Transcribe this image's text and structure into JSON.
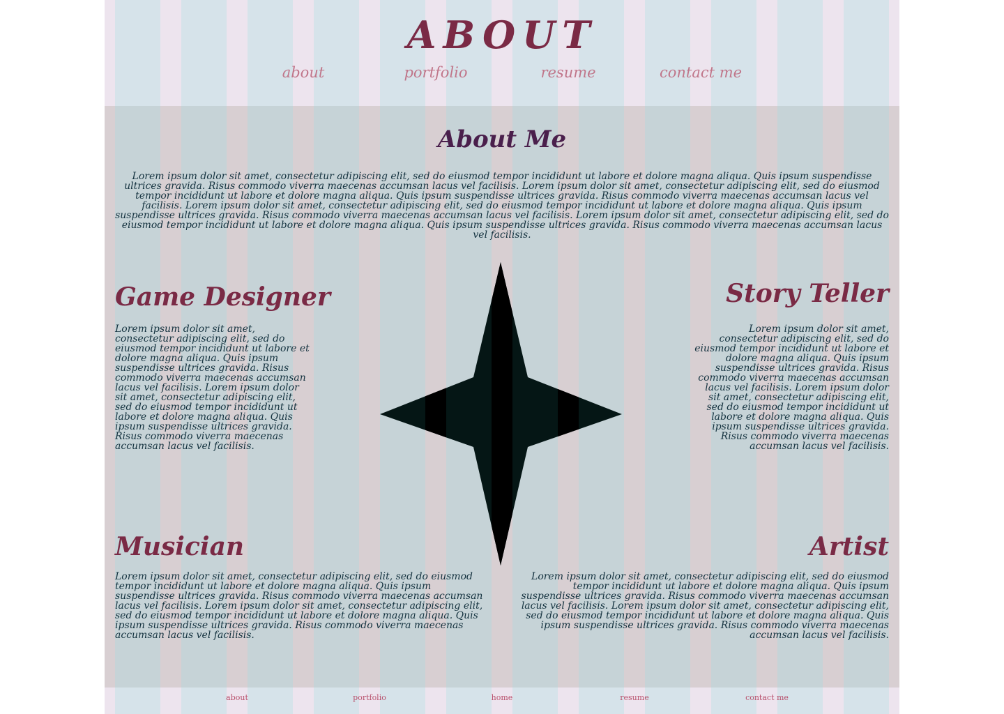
{
  "header": {
    "title": "ABOUT",
    "nav": [
      "about",
      "portfolio",
      "resume",
      "contact me"
    ]
  },
  "about": {
    "heading": "About Me",
    "intro": "Lorem ipsum dolor sit amet, consectetur adipiscing elit, sed do eiusmod tempor incididunt ut labore et dolore magna aliqua. Quis ipsum suspendisse ultrices gravida. Risus commodo viverra maecenas accumsan lacus vel facilisis. Lorem ipsum dolor sit amet, consectetur adipiscing elit, sed do eiusmod tempor incididunt ut labore et dolore magna aliqua. Quis ipsum suspendisse ultrices gravida. Risus commodo viverra maecenas accumsan lacus vel facilisis. Lorem ipsum dolor sit amet, consectetur adipiscing elit, sed do eiusmod tempor incididunt ut labore et dolore magna aliqua. Quis ipsum suspendisse ultrices gravida. Risus commodo viverra maecenas accumsan lacus vel facilisis. Lorem ipsum dolor sit amet, consectetur adipiscing elit, sed do eiusmod tempor incididunt ut labore et dolore magna aliqua. Quis ipsum suspendisse ultrices gravida. Risus commodo viverra maecenas accumsan lacus vel facilisis."
  },
  "roles": {
    "game": {
      "title": "Game Designer",
      "text": "Lorem ipsum dolor sit amet, consectetur adipiscing elit, sed do eiusmod tempor incididunt ut labore et dolore magna aliqua. Quis ipsum suspendisse ultrices gravida. Risus commodo viverra maecenas accumsan lacus vel facilisis. Lorem ipsum dolor sit amet, consectetur adipiscing elit, sed do eiusmod tempor incididunt ut labore et dolore magna aliqua. Quis ipsum suspendisse ultrices gravida. Risus commodo viverra maecenas accumsan lacus vel facilisis."
    },
    "story": {
      "title": "Story Teller",
      "text": "Lorem ipsum dolor sit amet, consectetur adipiscing elit, sed do eiusmod tempor incididunt ut labore et dolore magna aliqua. Quis ipsum suspendisse ultrices gravida. Risus commodo viverra maecenas accumsan lacus vel facilisis. Lorem ipsum dolor sit amet, consectetur adipiscing elit, sed do eiusmod tempor incididunt ut labore et dolore magna aliqua. Quis ipsum suspendisse ultrices gravida. Risus commodo viverra maecenas accumsan lacus vel facilisis."
    },
    "music": {
      "title": "Musician",
      "text": "Lorem ipsum dolor sit amet, consectetur adipiscing elit, sed do eiusmod tempor incididunt ut labore et dolore magna aliqua. Quis ipsum suspendisse ultrices gravida. Risus commodo viverra maecenas accumsan lacus vel facilisis. Lorem ipsum dolor sit amet, consectetur adipiscing elit, sed do eiusmod tempor incididunt ut labore et dolore magna aliqua. Quis ipsum suspendisse ultrices gravida. Risus commodo viverra maecenas accumsan lacus vel facilisis."
    },
    "artist": {
      "title": "Artist",
      "text": "Lorem ipsum dolor sit amet, consectetur adipiscing elit, sed do eiusmod tempor incididunt ut labore et dolore magna aliqua. Quis ipsum suspendisse ultrices gravida. Risus commodo viverra maecenas accumsan lacus vel facilisis. Lorem ipsum dolor sit amet, consectetur adipiscing elit, sed do eiusmod tempor incididunt ut labore et dolore magna aliqua. Quis ipsum suspendisse ultrices gravida. Risus commodo viverra maecenas accumsan lacus vel facilisis."
    }
  },
  "footer": {
    "nav": [
      "about",
      "portfolio",
      "home",
      "resume",
      "contact me"
    ]
  },
  "colors": {
    "title": "#7a2a45",
    "heading": "#4a1f4c",
    "nav_link": "#c0768a",
    "footer_link": "#b8506c",
    "body_text": "#14323f",
    "star": "#051615"
  },
  "icons": {
    "star": "four-point-star-icon"
  }
}
